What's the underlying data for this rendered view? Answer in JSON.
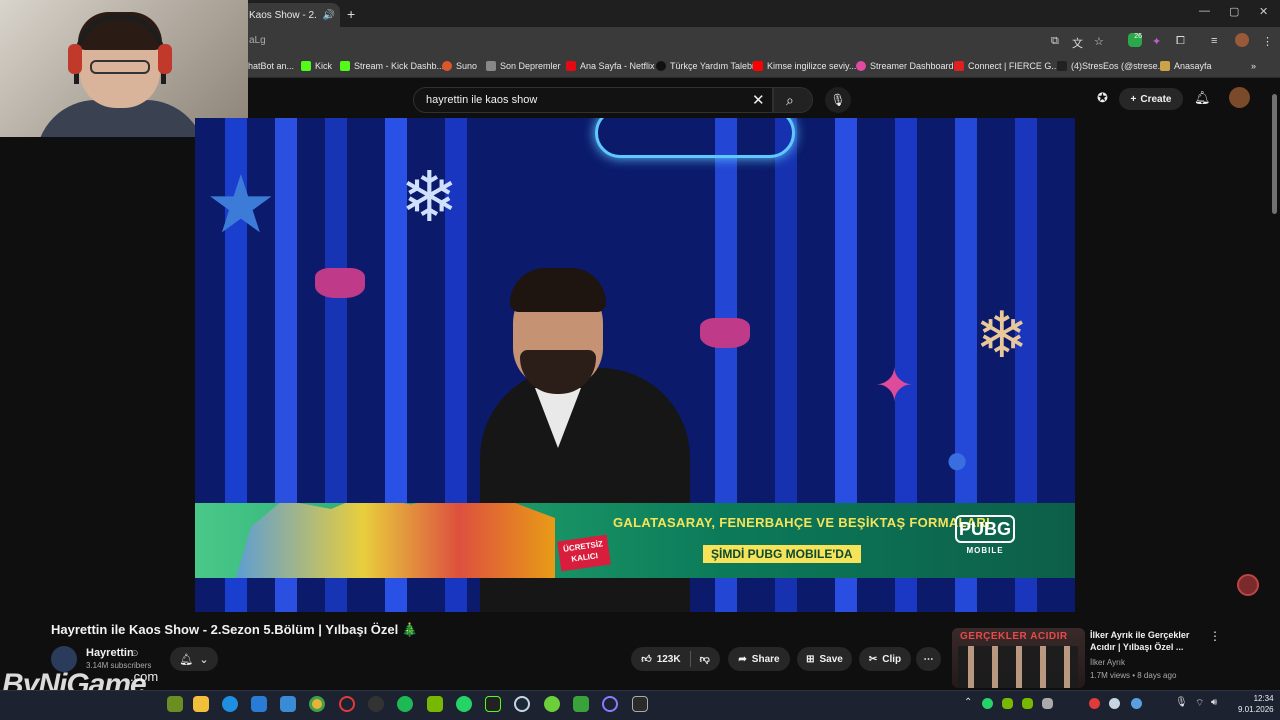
{
  "browser": {
    "tab_title": "Kaos Show - 2.",
    "url_fragment": "aLg",
    "new_tab_symbol": "+",
    "tab_close_symbol": "×",
    "extension_badge": "26",
    "window_controls": [
      "—",
      "▢",
      "✕"
    ]
  },
  "bookmarks": [
    {
      "label": "hatBot an...",
      "color": "#4a6"
    },
    {
      "label": "Kick",
      "color": "#53fc18"
    },
    {
      "label": "Stream - Kick Dashb...",
      "color": "#53fc18"
    },
    {
      "label": "Suno",
      "color": "#e0562b"
    },
    {
      "label": "Son Depremler",
      "color": "#888"
    },
    {
      "label": "Ana Sayfa - Netflix",
      "color": "#e50914"
    },
    {
      "label": "Türkçe Yardım Talebi",
      "color": "#111"
    },
    {
      "label": "Kimse ingilizce seviy...",
      "color": "#ff0000"
    },
    {
      "label": "Streamer Dashboard",
      "color": "#e04aa0"
    },
    {
      "label": "Connect | FIERCE G...",
      "color": "#e02020"
    },
    {
      "label": "(4)StresEos (@strese...",
      "color": "#222"
    },
    {
      "label": "Anasayfa",
      "color": "#c9a24a"
    }
  ],
  "youtube": {
    "search_value": "hayrettin ile kaos show",
    "create_label": "Create"
  },
  "ad": {
    "free_badge": "ÜCRETSİZ KALICI",
    "line1": "GALATASARAY, FENERBAHÇE VE BEŞİKTAŞ FORMALARI",
    "line2": "ŞİMDİ PUBG MOBILE'DA",
    "logo_top": "PUBG",
    "logo_bottom": "MOBILE"
  },
  "video": {
    "title": "Hayrettin ile Kaos Show - 2.Sezon 5.Bölüm | Yılbaşı Özel 🎄",
    "channel_name": "Hayrettin",
    "verified_mark": "⊙",
    "subscribers": "3.14M subscribers",
    "likes": "123K",
    "share_label": "Share",
    "save_label": "Save",
    "clip_label": "Clip"
  },
  "recommendation": {
    "thumb_text": "GERÇEKLER ACIDIR",
    "title": "İlker Ayrık ile Gerçekler Acıdır | Yılbaşı Özel ...",
    "channel": "İlker Ayrık",
    "meta": "1.7M views • 8 days ago"
  },
  "watermark": {
    "main": "ByNiGame",
    "suffix": ".com"
  },
  "clock": {
    "time": "12:34",
    "date": "9.01.2026"
  },
  "colors": {
    "youtube_bg": "#0f0f0f",
    "chrome_bar": "#3a3a3a",
    "taskbar": "#1c2230",
    "ad_yellow": "#f7e359"
  }
}
